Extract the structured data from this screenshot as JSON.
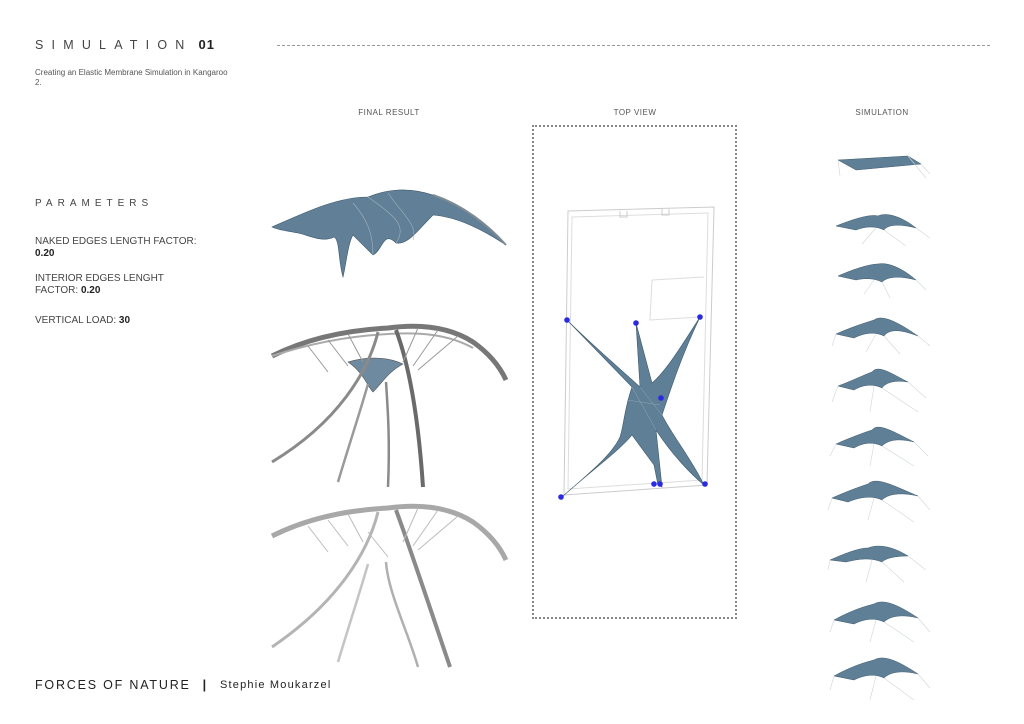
{
  "header": {
    "title": "SIMULATION",
    "number": "01",
    "subtitle": "Creating an Elastic Membrane Simulation  in Kangaroo 2."
  },
  "parameters": {
    "heading": "PARAMETERS",
    "naked_label": "NAKED EDGES LENGTH FACTOR:",
    "naked_value": "0.20",
    "interior_label": "INTERIOR EDGES LENGHT FACTOR:",
    "interior_value": "0.20",
    "load_label": "VERTICAL LOAD:",
    "load_value": "30"
  },
  "columns": {
    "final_result": "FINAL RESULT",
    "top_view": "TOP VIEW",
    "simulation": "SIMULATION"
  },
  "footer": {
    "project": "FORCES OF NATURE",
    "separator": "|",
    "author": "Stephie Moukarzel"
  },
  "colors": {
    "membrane": "#5f7f96",
    "membrane_dark": "#3e5a6e",
    "structure": "#7a7a7a",
    "anchor": "#2a2ae0"
  },
  "simulation_frames": 10
}
